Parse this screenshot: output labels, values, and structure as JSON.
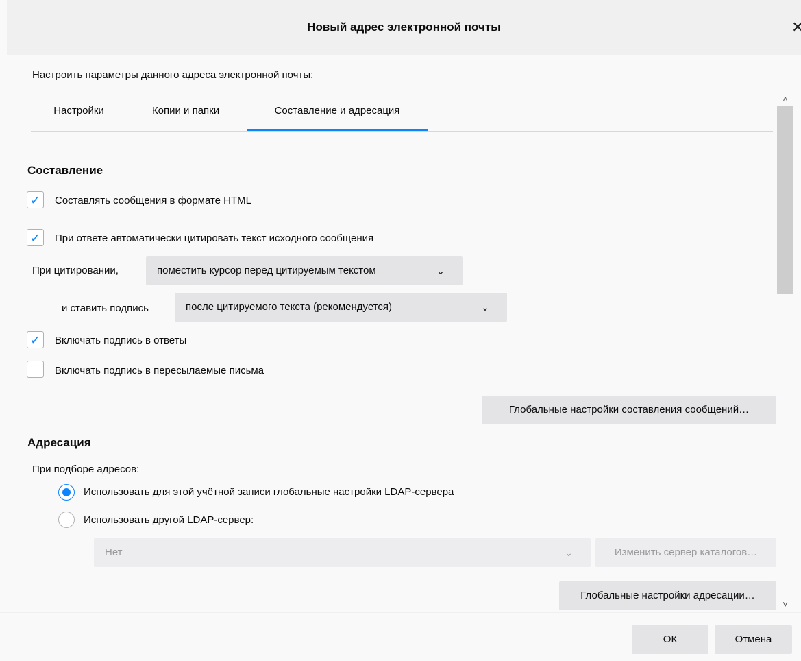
{
  "dialog": {
    "title": "Новый адрес электронной почты",
    "close_glyph": "✕",
    "intro": "Настроить параметры данного адреса электронной почты:"
  },
  "tabs": [
    {
      "label": "Настройки",
      "selected": false
    },
    {
      "label": "Копии и папки",
      "selected": false
    },
    {
      "label": "Составление и адресация",
      "selected": true
    }
  ],
  "composition": {
    "heading": "Составление",
    "html_format": {
      "label": "Составлять сообщения в формате HTML",
      "checked": true
    },
    "auto_quote": {
      "label": "При ответе автоматически цитировать текст исходного сообщения",
      "checked": true
    },
    "quoting_label": "При цитировании,",
    "quoting_select": "поместить курсор перед цитируемым текстом",
    "signature_label": "и ставить подпись",
    "signature_select": "после цитируемого текста (рекомендуется)",
    "include_sig_replies": {
      "label": "Включать подпись в ответы",
      "checked": true
    },
    "include_sig_forwards": {
      "label": "Включать подпись в пересылаемые письма",
      "checked": false
    },
    "global_button": "Глобальные настройки составления сообщений…"
  },
  "addressing": {
    "heading": "Адресация",
    "subheading": "При подборе адресов:",
    "radio_global": {
      "label": "Использовать для этой учётной записи глобальные настройки LDAP-сервера",
      "selected": true
    },
    "radio_other": {
      "label": "Использовать другой LDAP-сервер:",
      "selected": false
    },
    "server_select": "Нет",
    "edit_server_button": "Изменить сервер каталогов…",
    "global_button": "Глобальные настройки адресации…"
  },
  "footer": {
    "ok": "ОК",
    "cancel": "Отмена"
  },
  "icons": {
    "check": "✓",
    "chevron_down": "⌄",
    "scroll_up": "˄",
    "scroll_down": "˅"
  },
  "colors": {
    "accent": "#0a84ff",
    "button_bg": "#e4e4e6",
    "titlebar_bg": "#f0f0f0",
    "page_bg": "#f9f9fa"
  }
}
